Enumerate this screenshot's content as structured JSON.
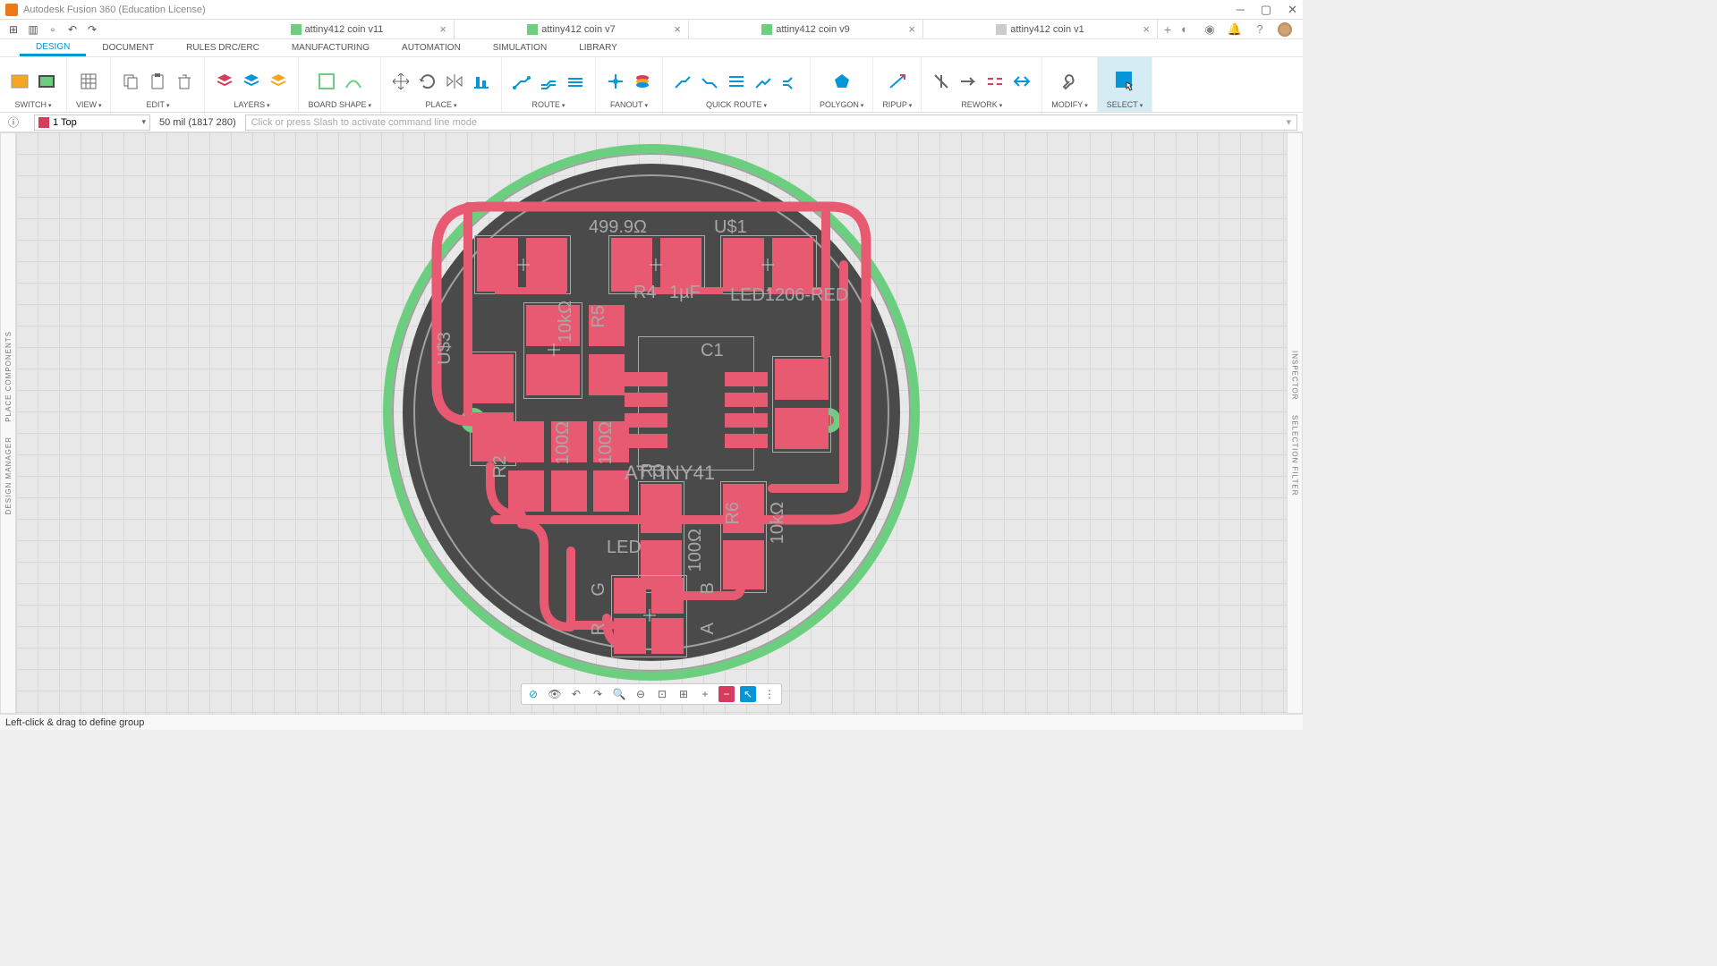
{
  "window": {
    "title": "Autodesk Fusion 360 (Education License)"
  },
  "tabs": [
    {
      "label": "attiny412 coin v11",
      "active": false
    },
    {
      "label": "attiny412 coin v7",
      "active": false
    },
    {
      "label": "attiny412 coin v9",
      "active": true
    },
    {
      "label": "attiny412 coin v1",
      "active": false
    }
  ],
  "menu": {
    "items": [
      "DESIGN",
      "DOCUMENT",
      "RULES DRC/ERC",
      "MANUFACTURING",
      "AUTOMATION",
      "SIMULATION",
      "LIBRARY"
    ],
    "active": "DESIGN"
  },
  "ribbon": [
    {
      "label": "SWITCH"
    },
    {
      "label": "VIEW"
    },
    {
      "label": "EDIT"
    },
    {
      "label": "LAYERS"
    },
    {
      "label": "BOARD SHAPE"
    },
    {
      "label": "PLACE"
    },
    {
      "label": "ROUTE"
    },
    {
      "label": "FANOUT"
    },
    {
      "label": "QUICK ROUTE"
    },
    {
      "label": "POLYGON"
    },
    {
      "label": "RIPUP"
    },
    {
      "label": "REWORK"
    },
    {
      "label": "MODIFY"
    },
    {
      "label": "SELECT"
    }
  ],
  "optionbar": {
    "layer": "1 Top",
    "grid_coord": "50 mil (1817 280)",
    "cmd_placeholder": "Click or press Slash to activate command line mode"
  },
  "rails": {
    "left_top": "PLACE COMPONENTS",
    "left_bottom": "DESIGN MANAGER",
    "right_top": "INSPECTOR",
    "right_bottom": "SELECTION FILTER"
  },
  "silkscreen": {
    "r_499": "499.9Ω",
    "us1": "U$1",
    "r4": "R4",
    "one_uf": "1µF",
    "led_red": "LED1206-RED",
    "u3": "U$3",
    "r5": "R5",
    "tenk": "10kΩ",
    "c1": "C1",
    "r2": "R2",
    "r3": "R3",
    "hundred1": "100Ω",
    "hundred2": "100Ω",
    "hundred3": "100Ω",
    "attiny": "ATTINY41",
    "led": "LED",
    "r6": "R6",
    "tenk2": "10kΩ",
    "g": "G",
    "r": "R",
    "b": "B",
    "a": "A"
  },
  "status": "Left-click & drag to define group"
}
